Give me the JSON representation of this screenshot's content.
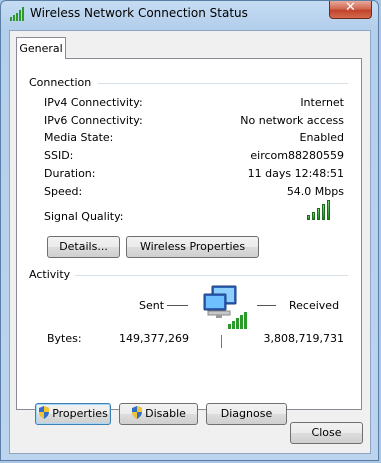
{
  "window": {
    "title": "Wireless Network Connection Status",
    "close_symbol": "✕"
  },
  "tabs": [
    {
      "label": "General"
    }
  ],
  "connection": {
    "group_label": "Connection",
    "rows": [
      {
        "label": "IPv4 Connectivity:",
        "value": "Internet"
      },
      {
        "label": "IPv6 Connectivity:",
        "value": "No network access"
      },
      {
        "label": "Media State:",
        "value": "Enabled"
      },
      {
        "label": "SSID:",
        "value": "eircom88280559"
      },
      {
        "label": "Duration:",
        "value": "11 days 12:48:51"
      },
      {
        "label": "Speed:",
        "value": "54.0 Mbps"
      }
    ],
    "signal_label": "Signal Quality:",
    "signal_bars_total": 5,
    "signal_bars_lit": 5,
    "details_button": "Details...",
    "wireless_properties_button": "Wireless Properties"
  },
  "activity": {
    "group_label": "Activity",
    "sent_label": "Sent",
    "received_label": "Received",
    "bytes_label": "Bytes:",
    "bytes_sent": "149,377,269",
    "bytes_received": "3,808,719,731",
    "properties_button": "Properties",
    "disable_button": "Disable",
    "diagnose_button": "Diagnose"
  },
  "footer": {
    "close_button": "Close"
  },
  "colors": {
    "accent": "#3c7fb1",
    "signal_green": "#1d8a1d",
    "close_red": "#c2432c"
  },
  "icons": [
    "wireless-signal-icon",
    "network-computers-icon",
    "uac-shield-icon"
  ]
}
